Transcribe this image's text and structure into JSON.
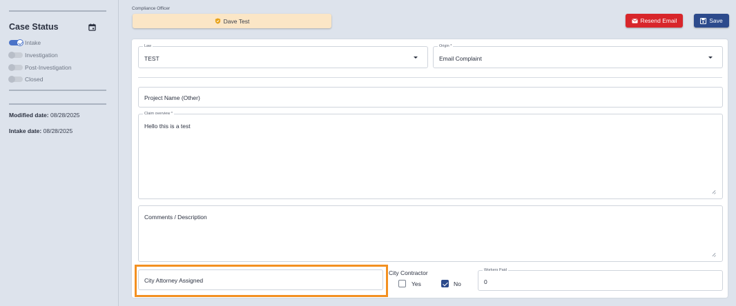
{
  "sidebar": {
    "case_status_title": "Case Status",
    "calendar_icon": "calendar-icon",
    "statuses": [
      {
        "label": "Intake",
        "active": true
      },
      {
        "label": "Investigation",
        "active": false
      },
      {
        "label": "Post-Investigation",
        "active": false
      },
      {
        "label": "Closed",
        "active": false
      }
    ],
    "modified_label": "Modified date:",
    "modified_value": "08/28/2025",
    "intake_label": "Intake date:",
    "intake_value": "08/28/2025"
  },
  "header": {
    "officer_label": "Compliance Officer",
    "officer_name": "Dave Test",
    "resend_label": "Resend Email",
    "save_label": "Save"
  },
  "form": {
    "law_label": "Law",
    "law_value": "TEST",
    "origin_label": "Origin *",
    "origin_value": "Email Complaint",
    "project_name_placeholder": "Project Name (Other)",
    "claim_label": "Claim overview *",
    "claim_value": "Hello this is a test",
    "comments_placeholder": "Comments / Description",
    "attorney_placeholder": "City Attorney Assigned",
    "city_contractor_title": "City Contractor",
    "yes_label": "Yes",
    "no_label": "No",
    "city_contractor_value": "No",
    "workers_paid_label": "Workers Paid",
    "workers_paid_value": "0"
  },
  "colors": {
    "accent": "#2c4a8c",
    "danger": "#d8262b",
    "highlight": "#f39021",
    "officer_pill": "#fbe6c6"
  }
}
